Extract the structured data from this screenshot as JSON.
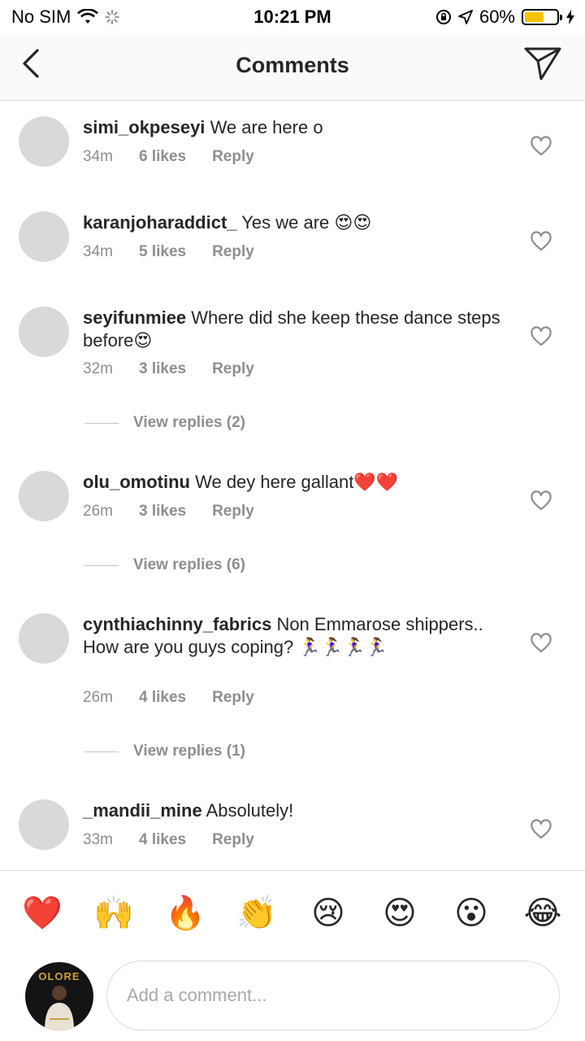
{
  "status_bar": {
    "carrier": "No SIM",
    "time": "10:21 PM",
    "battery": "60%",
    "battery_level": 0.6
  },
  "header": {
    "title": "Comments"
  },
  "comments": [
    {
      "username": "simi_okpeseyi",
      "text": "We are here o",
      "time": "34m",
      "likes": "6 likes",
      "reply": "Reply"
    },
    {
      "username": "karanjoharaddict_",
      "text": "Yes we are 😍😍",
      "time": "34m",
      "likes": "5 likes",
      "reply": "Reply"
    },
    {
      "username": "seyifunmiee",
      "text": "Where did she keep these dance steps before😍",
      "time": "32m",
      "likes": "3 likes",
      "reply": "Reply",
      "view_replies": "View replies (2)"
    },
    {
      "username": "olu_omotinu",
      "text": "We dey here gallant❤️❤️",
      "time": "26m",
      "likes": "3 likes",
      "reply": "Reply",
      "view_replies": "View replies (6)"
    },
    {
      "username": "cynthiachinny_fabrics",
      "text": "Non Emmarose shippers.. How are you guys coping? 🏃‍♀️🏃‍♀️🏃‍♀️🏃‍♀️",
      "time": "26m",
      "likes": "4 likes",
      "reply": "Reply",
      "view_replies": "View replies (1)"
    },
    {
      "username": "_mandii_mine",
      "text": "Absolutely!",
      "time": "33m",
      "likes": "4 likes",
      "reply": "Reply"
    }
  ],
  "emoji_bar": [
    "❤️",
    "🙌",
    "🔥",
    "👏",
    "😢",
    "😍",
    "😮",
    "😂"
  ],
  "composer": {
    "placeholder": "Add a comment...",
    "avatar_text": "OLORE"
  }
}
